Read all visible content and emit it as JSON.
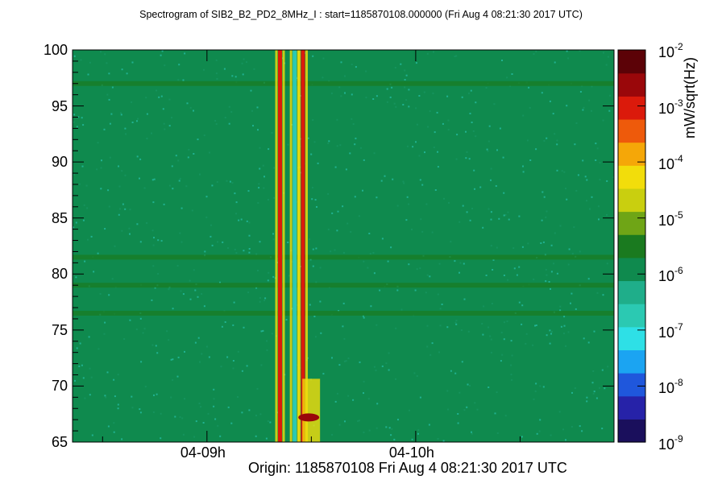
{
  "chart_data": {
    "type": "heatmap",
    "title": "Spectrogram of SIB2_B2_PD2_8MHz_I : start=1185870108.000000 (Fri Aug  4 08:21:30 2017 UTC)",
    "x_axis": {
      "type": "time",
      "ticks": [
        "04-09h",
        "04-10h"
      ],
      "offset_label": "Origin: 1185870108  Fri Aug  4 08:21:30 2017 UTC"
    },
    "y_axis": {
      "range": [
        65,
        100
      ],
      "ticks": [
        65,
        70,
        75,
        80,
        85,
        90,
        95,
        100
      ]
    },
    "z_axis": {
      "label": "mW/sqrt(Hz)",
      "scale": "log",
      "range": [
        1e-09,
        0.01
      ],
      "ticks": [
        {
          "base": "10",
          "exp": "-9"
        },
        {
          "base": "10",
          "exp": "-8"
        },
        {
          "base": "10",
          "exp": "-7"
        },
        {
          "base": "10",
          "exp": "-6"
        },
        {
          "base": "10",
          "exp": "-5"
        },
        {
          "base": "10",
          "exp": "-4"
        },
        {
          "base": "10",
          "exp": "-3"
        },
        {
          "base": "10",
          "exp": "-2"
        }
      ],
      "palette": [
        "#1a0f5c",
        "#2622a8",
        "#1f57dc",
        "#1ba4f2",
        "#2ee0e6",
        "#2bc9b2",
        "#1fae8a",
        "#0f8a4e",
        "#1a7a1f",
        "#6fa516",
        "#c9cf0f",
        "#f2dd0b",
        "#f5a708",
        "#ee5a0b",
        "#db1a0b",
        "#9a070a",
        "#5c0207"
      ]
    },
    "background_level": 1e-06,
    "features": [
      {
        "kind": "vertical_line",
        "time_hours": 9.35,
        "level": 0.001
      },
      {
        "kind": "vertical_line",
        "time_hours": 9.42,
        "level": 1e-07
      },
      {
        "kind": "vertical_line",
        "time_hours": 9.46,
        "level": 0.001
      },
      {
        "kind": "horizontal_band",
        "freq": 97.0,
        "level": 3e-06
      },
      {
        "kind": "horizontal_band",
        "freq": 81.5,
        "level": 3e-06
      },
      {
        "kind": "horizontal_band",
        "freq": 79.0,
        "level": 3e-06
      },
      {
        "kind": "horizontal_band",
        "freq": 76.5,
        "level": 2e-06
      },
      {
        "kind": "hot_spot",
        "time_hours": 9.48,
        "freq": 67.2,
        "level": 0.005
      }
    ]
  }
}
